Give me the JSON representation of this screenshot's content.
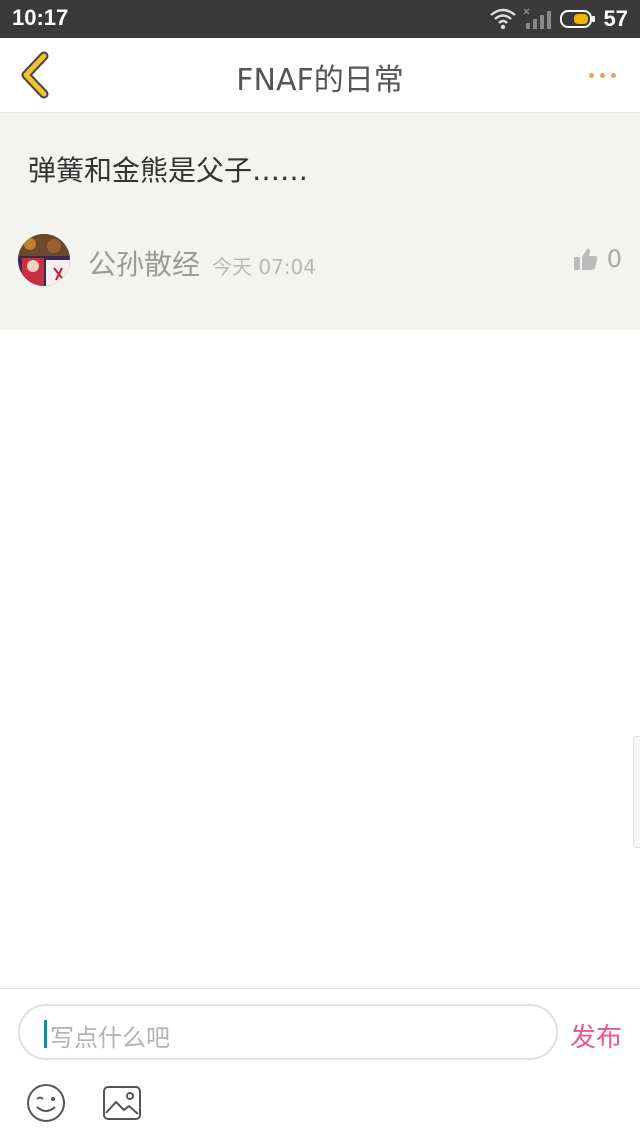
{
  "status_bar": {
    "time": "10:17",
    "battery": "57"
  },
  "header": {
    "title": "FNAF的日常",
    "back_icon": "chevron-left-icon",
    "more_icon": "more-dots-icon"
  },
  "post": {
    "text": "弹簧和金熊是父子……",
    "author": "公孙散经",
    "time": "今天 07:04",
    "likes": "0"
  },
  "composer": {
    "placeholder": "写点什么吧",
    "publish_label": "发布"
  },
  "colors": {
    "accent": "#e85a8a",
    "back": "#e0b020",
    "more": "#f0a060",
    "post_bg": "#f3f3ef"
  }
}
